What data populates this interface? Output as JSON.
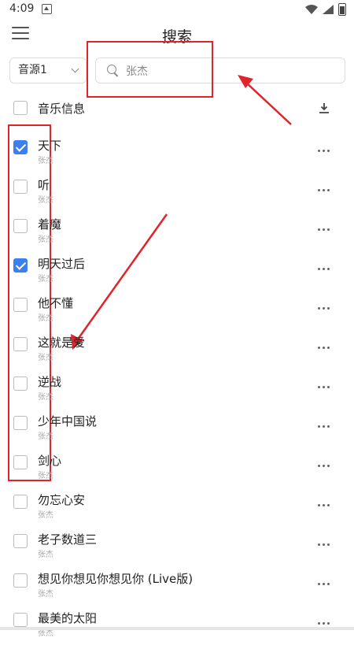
{
  "status": {
    "time": "4:09"
  },
  "title": "搜索",
  "source": {
    "selected": "音源1"
  },
  "search": {
    "value": "张杰",
    "placeholder": ""
  },
  "header": {
    "label": "音乐信息"
  },
  "songs": [
    {
      "title": "天下",
      "artist": "张杰",
      "checked": true
    },
    {
      "title": "听",
      "artist": "张杰",
      "checked": false
    },
    {
      "title": "着魔",
      "artist": "张杰",
      "checked": false
    },
    {
      "title": "明天过后",
      "artist": "张杰",
      "checked": true
    },
    {
      "title": "他不懂",
      "artist": "张杰",
      "checked": false
    },
    {
      "title": "这就是爱",
      "artist": "张杰",
      "checked": false
    },
    {
      "title": "逆战",
      "artist": "张杰",
      "checked": false
    },
    {
      "title": "少年中国说",
      "artist": "张杰",
      "checked": false
    },
    {
      "title": "剑心",
      "artist": "张杰",
      "checked": false
    },
    {
      "title": "勿忘心安",
      "artist": "张杰",
      "checked": false
    },
    {
      "title": "老子数道三",
      "artist": "张杰",
      "checked": false
    },
    {
      "title": "想见你想见你想见你 (Live版)",
      "artist": "张杰",
      "checked": false
    },
    {
      "title": "最美的太阳",
      "artist": "张杰",
      "checked": false
    }
  ],
  "colors": {
    "accent": "#3b7ff0",
    "annotation": "#e0242c"
  }
}
